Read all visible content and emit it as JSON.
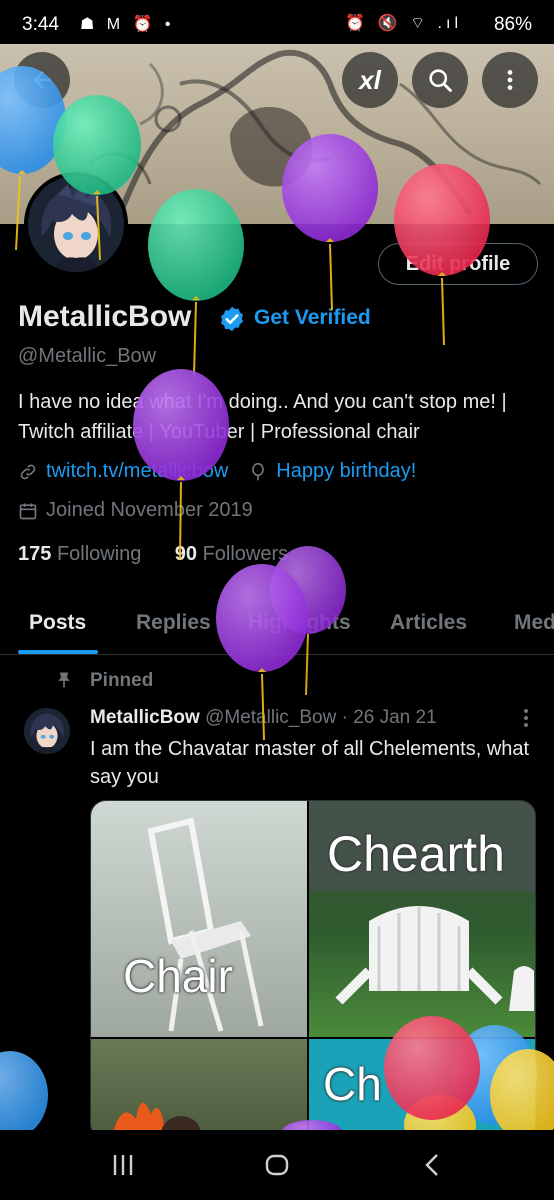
{
  "status_bar": {
    "time": "3:44",
    "left_icons": "☗ M ⏰ •",
    "right_icons": "⏰ 🔇 ⌔ .ıl",
    "battery": "86%"
  },
  "header_actions": {
    "back_icon": "back-arrow-icon",
    "grok_label": "xl",
    "search_icon": "search-icon",
    "more_icon": "more-vertical-icon"
  },
  "profile": {
    "edit_profile_label": "Edit profile",
    "display_name": "MetallicBow",
    "get_verified_label": "Get Verified",
    "handle": "@Metallic_Bow",
    "bio": "I have no idea what I'm doing.. And you can't stop me! | Twitch affiliate | YouTuber | Professional chair",
    "website": "twitch.tv/metallicbow",
    "birthday": "Happy birthday!",
    "joined": "Joined November 2019",
    "following_count": "175",
    "following_label": "Following",
    "followers_count": "90",
    "followers_label": "Followers"
  },
  "tabs": [
    {
      "label": "Posts",
      "active": true
    },
    {
      "label": "Replies",
      "active": false
    },
    {
      "label": "Highlights",
      "active": false
    },
    {
      "label": "Articles",
      "active": false
    },
    {
      "label": "Media",
      "active": false
    }
  ],
  "pinned_post": {
    "pinned_label": "Pinned",
    "author_name": "MetallicBow",
    "author_handle": "@Metallic_Bow",
    "separator": "·",
    "date": "26 Jan 21",
    "text": "I am the Chavatar master of all Chelements, what say you",
    "media_labels": {
      "top_left": "Chair",
      "top_right": "Chearth",
      "bottom_right": "Ch"
    }
  },
  "colors": {
    "accent": "#1d9bf0",
    "text_primary": "#e7e9ea",
    "text_secondary": "#71767b",
    "balloon_purple": "#8e2bd6",
    "balloon_green": "#27c98a",
    "balloon_pink": "#e8294f",
    "balloon_blue": "#2b8fe6",
    "balloon_yellow": "#f2c21b"
  }
}
